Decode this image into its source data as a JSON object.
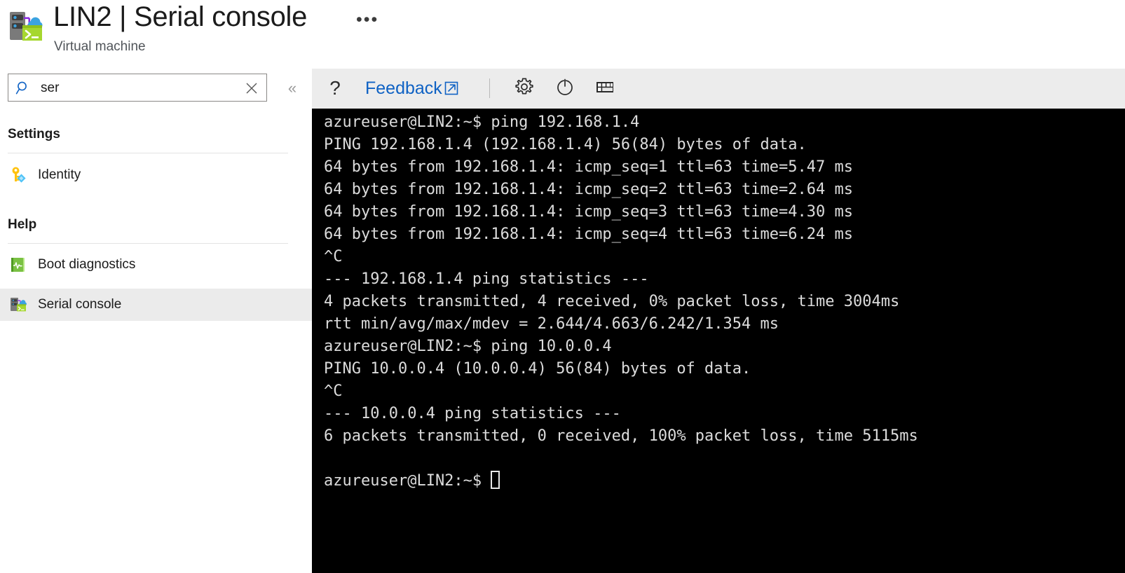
{
  "header": {
    "title": "LIN2 | Serial console",
    "subtitle": "Virtual machine",
    "ellipsis": "•••",
    "icon": "vm-serial-console-icon"
  },
  "sidebar": {
    "search": {
      "value": "ser",
      "placeholder": "Search",
      "icon": "search-icon",
      "clear_icon": "close-icon"
    },
    "collapse": {
      "label": "«",
      "icon": "chevron-double-left-icon"
    },
    "sections": [
      {
        "title": "Settings"
      },
      {
        "title": "Help"
      }
    ],
    "items": [
      {
        "label": "Identity",
        "icon": "key-icon",
        "selected": false
      },
      {
        "label": "Boot diagnostics",
        "icon": "boot-diagnostics-icon",
        "selected": false
      },
      {
        "label": "Serial console",
        "icon": "vm-serial-console-icon",
        "selected": true
      }
    ]
  },
  "toolbar": {
    "help_label": "?",
    "feedback_label": "Feedback",
    "feedback_icon": "external-link-icon",
    "settings_icon": "gear-icon",
    "power_icon": "power-icon",
    "keyboard_icon": "keyboard-icon"
  },
  "terminal": {
    "lines": [
      "azureuser@LIN2:~$ ping 192.168.1.4",
      "PING 192.168.1.4 (192.168.1.4) 56(84) bytes of data.",
      "64 bytes from 192.168.1.4: icmp_seq=1 ttl=63 time=5.47 ms",
      "64 bytes from 192.168.1.4: icmp_seq=2 ttl=63 time=2.64 ms",
      "64 bytes from 192.168.1.4: icmp_seq=3 ttl=63 time=4.30 ms",
      "64 bytes from 192.168.1.4: icmp_seq=4 ttl=63 time=6.24 ms",
      "^C",
      "--- 192.168.1.4 ping statistics ---",
      "4 packets transmitted, 4 received, 0% packet loss, time 3004ms",
      "rtt min/avg/max/mdev = 2.644/4.663/6.242/1.354 ms",
      "azureuser@LIN2:~$ ping 10.0.0.4",
      "PING 10.0.0.4 (10.0.0.4) 56(84) bytes of data.",
      "^C",
      "--- 10.0.0.4 ping statistics ---",
      "6 packets transmitted, 0 received, 100% packet loss, time 5115ms",
      ""
    ],
    "prompt": "azureuser@LIN2:~$ ",
    "cursor": "block-outline-cursor"
  },
  "colors": {
    "accent_blue": "#0f62c4",
    "toolbar_bg": "#ececec",
    "terminal_bg": "#000000",
    "terminal_fg": "#dcdcdc",
    "selected_row": "#ebebeb"
  }
}
